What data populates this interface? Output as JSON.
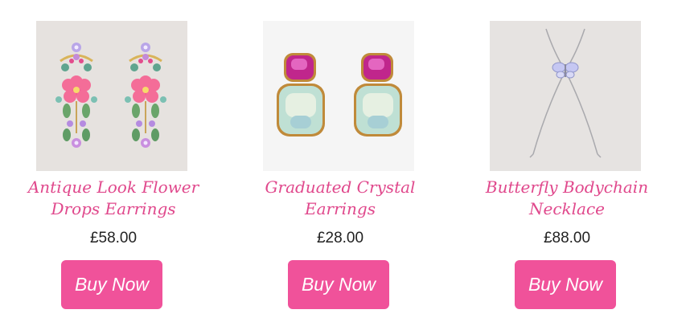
{
  "products": [
    {
      "title_line1": "Antique Look Flower",
      "title_line2": "Drops Earrings",
      "price": "£58.00",
      "buy_label": "Buy Now",
      "image_icon": "flower-drop-earrings-image"
    },
    {
      "title_line1": "Graduated Crystal",
      "title_line2": "Earrings",
      "price": "£28.00",
      "buy_label": "Buy Now",
      "image_icon": "crystal-earrings-image"
    },
    {
      "title_line1": "Butterfly Bodychain",
      "title_line2": "Necklace",
      "price": "£88.00",
      "buy_label": "Buy Now",
      "image_icon": "butterfly-bodychain-image"
    }
  ],
  "colors": {
    "accent": "#f0529a",
    "title": "#e0488c",
    "price": "#222222",
    "background": "#ffffff"
  }
}
